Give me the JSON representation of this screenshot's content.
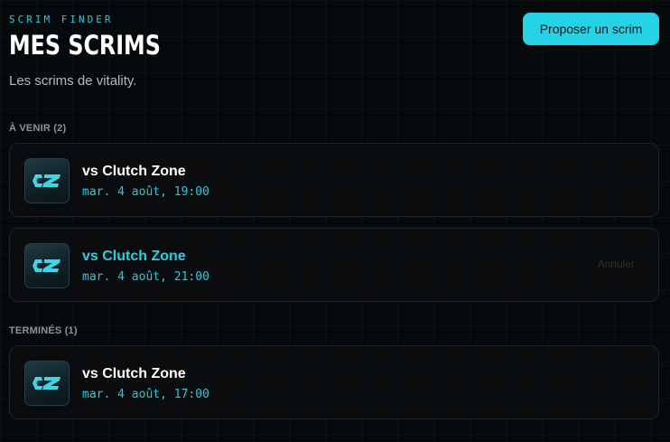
{
  "header": {
    "eyebrow": "SCRIM FINDER",
    "title": "MES SCRIMS",
    "subtitle": "Les scrims de vitality.",
    "propose_label": "Proposer un scrim"
  },
  "sections": {
    "upcoming_label": "À VENIR (2)",
    "finished_label": "TERMINÉS (1)"
  },
  "upcoming": [
    {
      "opponent": "vs Clutch Zone",
      "datetime": "mar. 4 août, 19:00",
      "logo": "clutch-zone-logo"
    },
    {
      "opponent": "vs Clutch Zone",
      "datetime": "mar. 4 août, 21:00",
      "logo": "clutch-zone-logo",
      "cancel_label": "Annuler"
    }
  ],
  "finished": [
    {
      "opponent": "vs Clutch Zone",
      "datetime": "mar. 4 août, 17:00",
      "logo": "clutch-zone-logo"
    }
  ],
  "colors": {
    "accent": "#26d3e6",
    "background": "#070a0c",
    "card_border": "#1d2428"
  }
}
